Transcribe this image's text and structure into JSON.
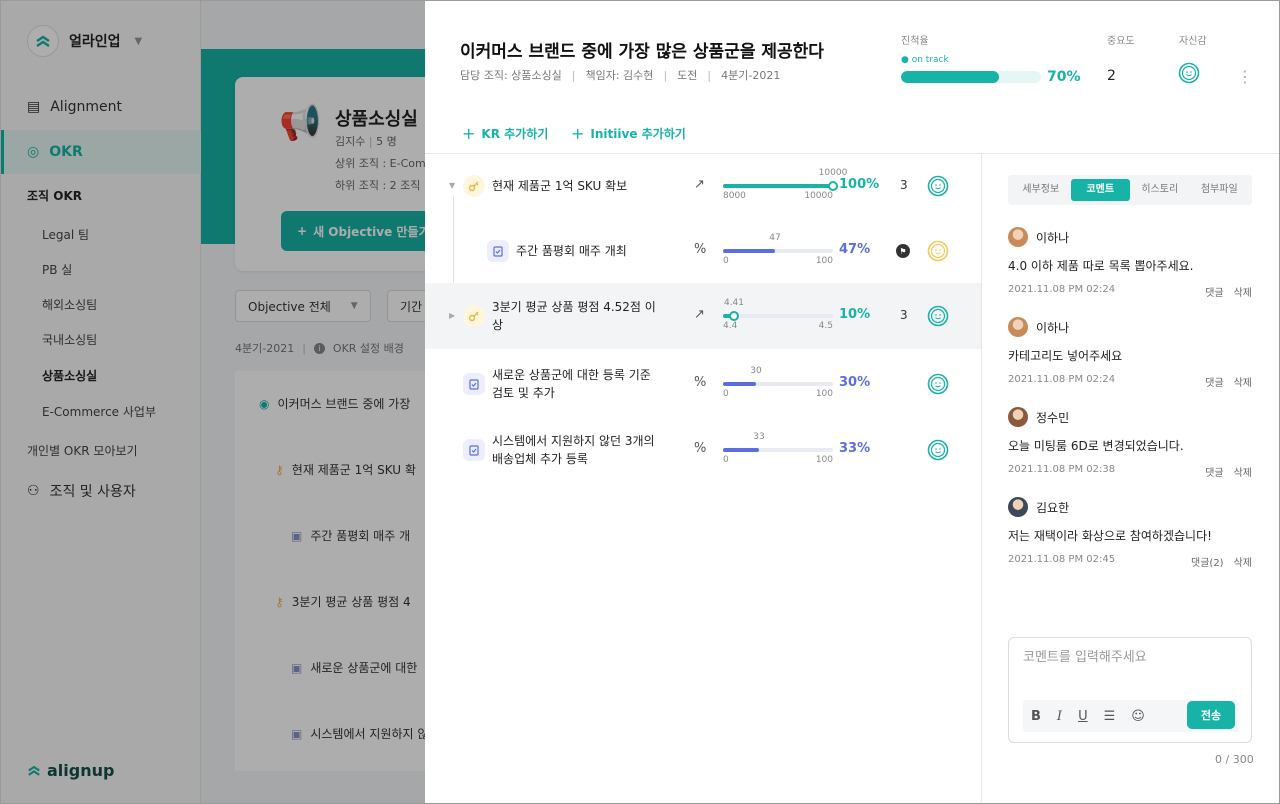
{
  "workspace": {
    "name": "얼라인업"
  },
  "sidebar": {
    "alignment": "Alignment",
    "okr": "OKR",
    "org_okr": "조직 OKR",
    "teams": [
      "Legal 팀",
      "PB 실",
      "해외소싱팀",
      "국내소싱팀",
      "상품소싱실",
      "E-Commerce 사업부"
    ],
    "personal": "개인별 OKR 모아보기",
    "org_users": "조직 및 사용자",
    "brand": "alignup"
  },
  "team_card": {
    "name": "상품소싱실",
    "leader": "김지수",
    "members": "5 명",
    "parent": "상위 조직 : E-Comm",
    "children": "하위 조직 : 2 조직",
    "new_objective": "새 Objective 만들기"
  },
  "filters": {
    "objective": "Objective 전체",
    "period": "기간"
  },
  "period_row": {
    "period": "4분기-2021",
    "background": "OKR 설정 배경"
  },
  "bg_list": [
    "이커머스 브랜드 중에 가장",
    "현재 제품군 1억 SKU 확",
    "주간 품평회 매주 개",
    "3분기 평균 상품 평점 4",
    "새로운 상품군에 대한",
    "시스템에서 지원하지 않"
  ],
  "objective": {
    "title": "이커머스 브랜드 중에 가장 많은 상품군을 제공한다",
    "org": "담당 조직: 상품소싱실",
    "owner": "책임자: 김수현",
    "type": "도전",
    "period": "4분기-2021",
    "progress_label": "진척율",
    "status": "on track",
    "progress": 70,
    "progress_text": "70%",
    "importance_label": "중요도",
    "importance": "2",
    "confidence_label": "자신감"
  },
  "actions": {
    "add_kr": "KR 추가하기",
    "add_initiative": "Initiive 추가하기"
  },
  "rows": [
    {
      "type": "kr",
      "text": "현재 제품군 1억 SKU 확보",
      "arrow": "↗",
      "top": "10000",
      "min": "8000",
      "max": "10000",
      "fill": 1.0,
      "pct": "100%",
      "count": "3",
      "color": "#17b3a6",
      "mood": "#17b3a6"
    },
    {
      "type": "task",
      "text": "주간 품평회 매주 개최",
      "arrow": "%",
      "top": "47",
      "min": "0",
      "max": "100",
      "fill": 0.47,
      "pct": "47%",
      "count": "",
      "color": "#5b6ee1",
      "mood": "#f0c95a"
    },
    {
      "type": "kr",
      "text": "3분기 평균 상품 평점 4.52점 이상",
      "arrow": "↗",
      "top": "4.41",
      "min": "4.4",
      "max": "4.5",
      "fill": 0.1,
      "pct": "10%",
      "count": "3",
      "color": "#17b3a6",
      "mood": "#17b3a6"
    },
    {
      "type": "task",
      "text": "새로운 상품군에 대한 등록 기준 검토 및 추가",
      "arrow": "%",
      "top": "30",
      "min": "0",
      "max": "100",
      "fill": 0.3,
      "pct": "30%",
      "count": "",
      "color": "#5b6ee1",
      "mood": "#17b3a6"
    },
    {
      "type": "task",
      "text": "시스템에서 지원하지 않던 3개의 배송업체 추가 등록",
      "arrow": "%",
      "top": "33",
      "min": "0",
      "max": "100",
      "fill": 0.33,
      "pct": "33%",
      "count": "",
      "color": "#5b6ee1",
      "mood": "#17b3a6"
    }
  ],
  "tabs": [
    "세부정보",
    "코멘트",
    "히스토리",
    "첨부파일"
  ],
  "comments": [
    {
      "author": "이하나",
      "body": "4.0 이하 제품 따로 목록 뽑아주세요.",
      "time": "2021.11.08  PM 02:24",
      "reply": "댓글",
      "delete": "삭제",
      "avatar": "#c98a5a"
    },
    {
      "author": "이하나",
      "body": "카테고리도 넣어주세요",
      "time": "2021.11.08  PM 02:24",
      "reply": "댓글",
      "delete": "삭제",
      "avatar": "#c98a5a"
    },
    {
      "author": "정수민",
      "body": "오늘 미팅룸 6D로 변경되었습니다.",
      "time": "2021.11.08  PM 02:38",
      "reply": "댓글",
      "delete": "삭제",
      "avatar": "#8a5a3a"
    },
    {
      "author": "김요한",
      "body": "저는 재택이라 화상으로 참여하겠습니다!",
      "time": "2021.11.08  PM 02:45",
      "reply": "댓글(2)",
      "delete": "삭제",
      "avatar": "#3a4a5a"
    }
  ],
  "editor": {
    "placeholder": "코멘트를 입력해주세요",
    "send": "전송",
    "counter": "0 / 300"
  }
}
